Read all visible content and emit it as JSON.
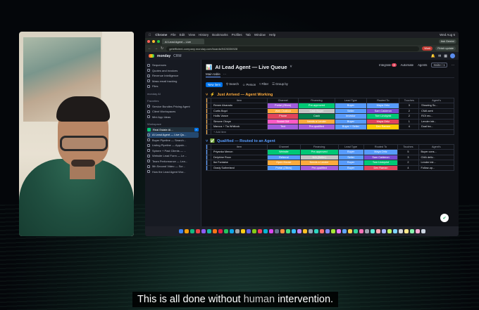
{
  "mac_menu": [
    "Chrome",
    "File",
    "Edit",
    "View",
    "History",
    "Bookmarks",
    "Profiles",
    "Tab",
    "Window",
    "Help"
  ],
  "mac_clock": "Wed Aug 6",
  "browser": {
    "tab_title": "AI Lead Agent – Live",
    "url": "getefficient-company.monday.com/boards/9426336928",
    "work_label": "Work",
    "finish_update": "Finish update",
    "ask_gemini": "Ask Gemini"
  },
  "app": {
    "brand": "monday",
    "product": "CRM"
  },
  "sidebar": {
    "top": [
      "Sequences",
      "Quotes and invoices",
      "Revenue Intelligence",
      "Mass email tracking",
      "Files"
    ],
    "monday_ai": "monday AI",
    "favorites_label": "Favorites",
    "favorites": [
      "Service Bundles Pricing Agent",
      "Client Workspaces",
      "Mini App Ideas"
    ],
    "workspaces_label": "Workspace",
    "workspace_name": "Real Estate AI...",
    "boards": [
      "AI Lead Agent — Live Qu...",
      "Buyer Pipeline — Search...",
      "Listing Pipeline — Appoin...",
      "Sphere + Past Clients — ...",
      "Website Lead Form — Le...",
      "Team Performance — Lea...",
      "5th Second Video — Scr...",
      "How the Lead Agent Wor..."
    ]
  },
  "board": {
    "title": "AI Lead Agent — Live Queue",
    "main_table": "Main table",
    "tools": [
      "Integrate",
      "Automate",
      "Agents",
      "Invite / 1"
    ],
    "integrate_badge": "3",
    "filters": [
      "New item",
      "Search",
      "Person",
      "Filter",
      "Group by"
    ],
    "columns": [
      "Item",
      "Channel",
      "Financing",
      "Lead Type",
      "Routed To",
      "Touches",
      "Agent's"
    ],
    "add_item": "+ Add item",
    "groups": [
      {
        "name": "Just Arrived — Agent Working",
        "color": "#fdab3d",
        "rows": [
          {
            "item": "Renee Alvarado",
            "channel": "Portal (Zillow)",
            "financing": "Pre-approved",
            "lead": "Buyer",
            "routed": "Maya Ortiz",
            "touches": "3",
            "note": "Showing Sc..."
          },
          {
            "item": "Curtis Boyd",
            "channel": "Web Chatbot",
            "financing": "Cash Buyer",
            "lead": "Seller",
            "routed": "Sam Calderon",
            "touches": "2",
            "note": "CMA sent"
          },
          {
            "item": "Hollis Vance",
            "channel": "Phone",
            "financing": "Cash",
            "lead": "Investor",
            "routed": "Tom Lindqvist",
            "touches": "2",
            "note": "ROI rec..."
          },
          {
            "item": "Simone Okoye",
            "channel": "Social DM",
            "financing": "Needs a Lender",
            "lead": "Buyer",
            "routed": "Maya Ortiz",
            "touches": "1",
            "note": "Lender intr..."
          },
          {
            "item": "Marcus + Tia Whitlock",
            "channel": "Text",
            "financing": "Pre-qualified",
            "lead": "Buyer + Seller",
            "routed": "Dev Raman",
            "touches": "4",
            "note": "Dual tra..."
          }
        ]
      },
      {
        "name": "Qualified — Routed to an Agent",
        "color": "#579bfc",
        "rows": [
          {
            "item": "Priyanka Menon",
            "channel": "Website",
            "financing": "Pre-approved",
            "lead": "Buyer",
            "routed": "Maya Ortiz",
            "touches": "5",
            "note": "Buyer cons..."
          },
          {
            "item": "Delphine Roux",
            "channel": "Referral",
            "financing": "N/A (Seller)",
            "lead": "Seller",
            "routed": "Sam Calderon",
            "touches": "3",
            "note": "CMA deliv..."
          },
          {
            "item": "Ike Fontaine",
            "channel": "Open House",
            "financing": "Needs a Lender",
            "lead": "Buyer",
            "routed": "Tom Lindqvist",
            "touches": "2",
            "note": "Lender intr..."
          },
          {
            "item": "Grady Sutherland",
            "channel": "Portal (Zillow)",
            "financing": "Pre-qualified",
            "lead": "Buyer",
            "routed": "Dev Raman",
            "touches": "4",
            "note": "Follow-up..."
          }
        ]
      }
    ]
  },
  "status_colors": {
    "channel": [
      "#a25ddc",
      "#fdab3d",
      "#e2445c",
      "#ff5ac4",
      "#a25ddc",
      "#00c875",
      "#579bfc",
      "#fdab3d",
      "#579bfc"
    ],
    "financing": [
      "#00c875",
      "#c4c4c4",
      "#037f4c",
      "#fdab3d",
      "#a25ddc",
      "#00c875",
      "#c4c4c4",
      "#fdab3d",
      "#a25ddc"
    ],
    "lead": "#579bfc",
    "routed": [
      "#579bfc",
      "#784bd1",
      "#00c875",
      "#e2445c",
      "#ffcb00"
    ]
  },
  "caption": {
    "part1": "This is all done without",
    "part2": "human",
    "part3": "intervention."
  }
}
